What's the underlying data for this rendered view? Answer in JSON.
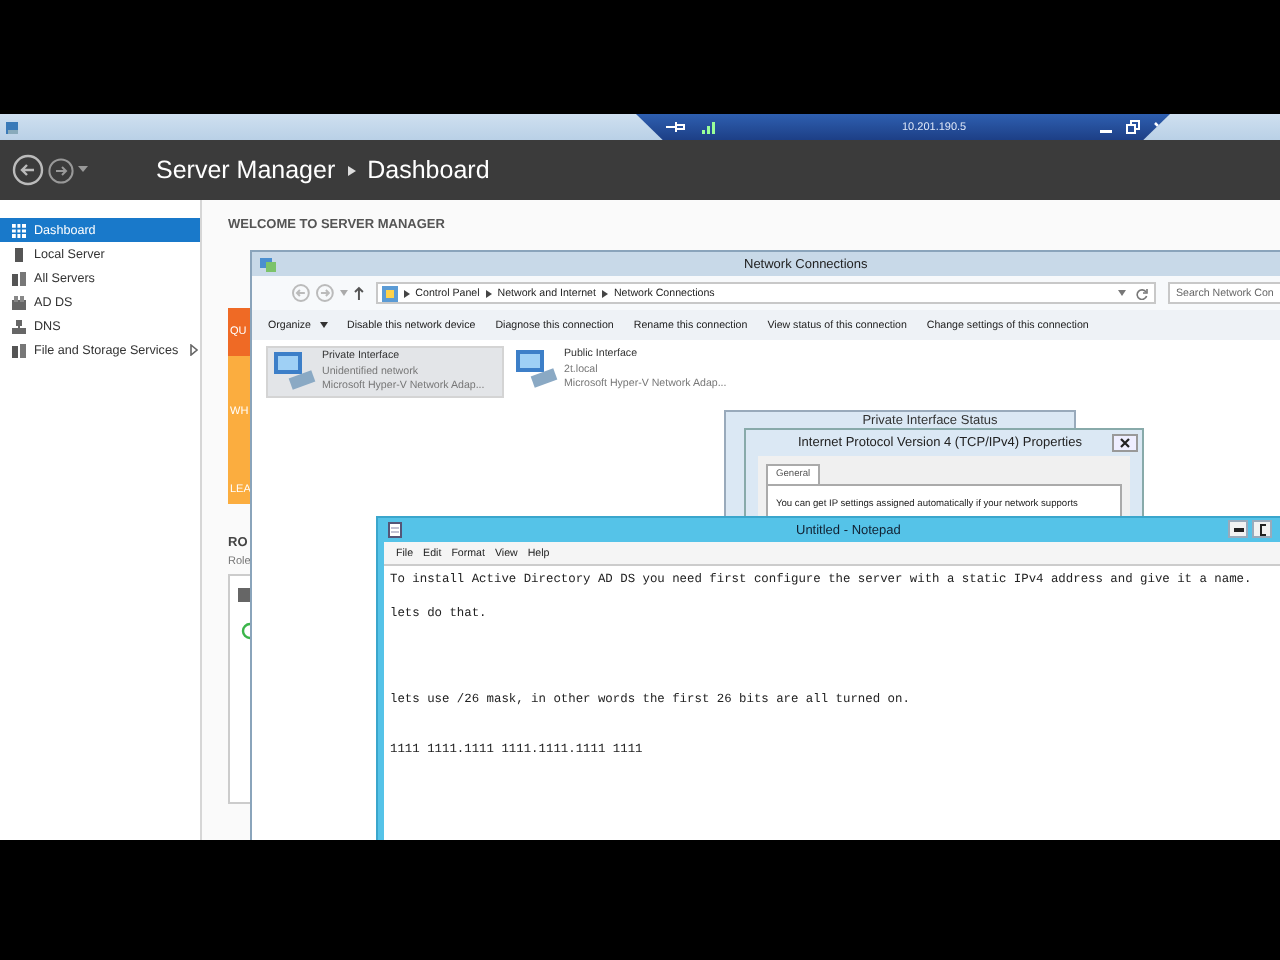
{
  "rdp_bar": {
    "address": "10.201.190.5"
  },
  "server_manager": {
    "breadcrumb": [
      "Server Manager",
      "Dashboard"
    ],
    "sidebar": {
      "items": [
        {
          "label": "Dashboard",
          "kind": "dashboard",
          "selected": true,
          "expandable": false
        },
        {
          "label": "Local Server",
          "kind": "server",
          "selected": false,
          "expandable": false
        },
        {
          "label": "All Servers",
          "kind": "servers",
          "selected": false,
          "expandable": false
        },
        {
          "label": "AD DS",
          "kind": "role",
          "selected": false,
          "expandable": false
        },
        {
          "label": "DNS",
          "kind": "network",
          "selected": false,
          "expandable": false
        },
        {
          "label": "File and Storage Services",
          "kind": "servers",
          "selected": false,
          "expandable": true
        }
      ]
    },
    "welcome_heading": "WELCOME TO SERVER MANAGER",
    "tile_labels": [
      "QU",
      "WH",
      "LEA"
    ],
    "roles_heading": "RO",
    "roles_subtitle": "Role"
  },
  "network_connections": {
    "title": "Network Connections",
    "address": [
      "Control Panel",
      "Network and Internet",
      "Network Connections"
    ],
    "search": {
      "placeholder": "Search Network Con"
    },
    "toolbar": [
      {
        "label": "Organize",
        "menu": true
      },
      {
        "label": "Disable this network device",
        "menu": false
      },
      {
        "label": "Diagnose this connection",
        "menu": false
      },
      {
        "label": "Rename this connection",
        "menu": false
      },
      {
        "label": "View status of this connection",
        "menu": false
      },
      {
        "label": "Change settings of this connection",
        "menu": false
      }
    ],
    "items": [
      {
        "name": "Private Interface",
        "status": "Unidentified network",
        "adapter": "Microsoft Hyper-V Network Adap...",
        "selected": true
      },
      {
        "name": "Public Interface",
        "status": "2t.local",
        "adapter": "Microsoft Hyper-V Network Adap...",
        "selected": false
      }
    ]
  },
  "status_dialog": {
    "title": "Private Interface Status"
  },
  "ipv4_dialog": {
    "title": "Internet Protocol Version 4 (TCP/IPv4) Properties",
    "tabs": [
      {
        "label": "General",
        "selected": true
      }
    ],
    "text": "You can get IP settings assigned automatically if your network supports"
  },
  "notepad": {
    "title": "Untitled - Notepad",
    "menu": [
      "File",
      "Edit",
      "Format",
      "View",
      "Help"
    ],
    "text": "To install Active Directory AD DS you need first configure the server with a static IPv4 address and give it a name.\n\nlets do that.\n\n\n\n\nlets use /26 mask, in other words the first 26 bits are all turned on.\n\n\n1111 1111.1111 1111.1111.1111 1111"
  }
}
